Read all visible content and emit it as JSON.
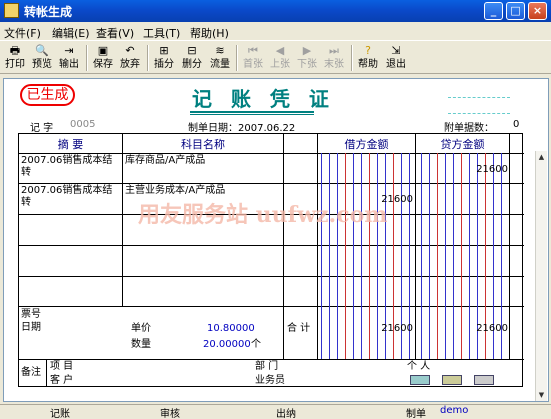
{
  "window": {
    "title": "转帐生成"
  },
  "menu": [
    "文件(F)",
    "编辑(E)",
    "查看(V)",
    "工具(T)",
    "帮助(H)"
  ],
  "toolbar": {
    "print": "打印",
    "preview": "预览",
    "export": "输出",
    "save": "保存",
    "discard": "放弃",
    "insert": "插分",
    "delete": "删分",
    "flow": "流量",
    "first": "首张",
    "prev": "上张",
    "next": "下张",
    "last": "末张",
    "help": "帮助",
    "exit": "退出"
  },
  "voucher": {
    "stamp": "已生成",
    "title": "记 账 凭 证",
    "word_label": "记 字",
    "word_no": "0005",
    "date_label": "制单日期：2007.06.22",
    "attach_label": "附单据数：",
    "attach_count": "0",
    "headers": {
      "summary": "摘 要",
      "account": "科目名称",
      "debit": "借方金额",
      "credit": "贷方金额"
    },
    "rows": [
      {
        "summary": "2007.06销售成本结转",
        "account": "库存商品/A产成品",
        "debit": "",
        "credit": "21600"
      },
      {
        "summary": "2007.06销售成本结转",
        "account": "主营业务成本/A产成品",
        "debit": "21600",
        "credit": ""
      }
    ],
    "footer": {
      "ticket": "票号",
      "date": "日期",
      "price_label": "单价",
      "price": "10.80000",
      "qty_label": "数量",
      "qty": "20.00000",
      "qty_unit": "个",
      "total_label": "合 计",
      "total_debit": "21600",
      "total_credit": "21600",
      "remark": "备注",
      "project": "项 目",
      "customer": "客 户",
      "dept": "部 门",
      "salesman": "业务员",
      "person": "个 人"
    },
    "watermark": "用友服务站 uufwz.com"
  },
  "status": {
    "bookkeep": "记账",
    "audit": "审核",
    "cashier": "出纳",
    "maker_label": "制单",
    "maker": "demo"
  }
}
